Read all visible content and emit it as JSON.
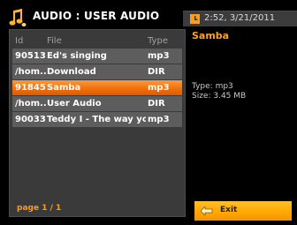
{
  "header": {
    "title": "AUDIO : USER AUDIO",
    "datetime": "2:52, 3/21/2011",
    "logo_icon": "music-notes-icon",
    "clock_icon": "clock-icon"
  },
  "list": {
    "columns": {
      "id": "Id",
      "file": "File",
      "type": "Type"
    },
    "rows": [
      {
        "id": "90513",
        "file": "Ed's singing",
        "type": "mp3",
        "selected": false
      },
      {
        "id": "/hom...",
        "file": "Download",
        "type": "DIR",
        "selected": false
      },
      {
        "id": "91845",
        "file": "Samba",
        "type": "mp3",
        "selected": true
      },
      {
        "id": "/hom...",
        "file": "User Audio",
        "type": "DIR",
        "selected": false
      },
      {
        "id": "90033",
        "file": "Teddy I - The way you",
        "type": "mp3",
        "selected": false
      }
    ],
    "page_label": "page 1 / 1"
  },
  "details": {
    "title": "Samba",
    "type_line": "Type: mp3",
    "size_line": "Size: 3.45 MB"
  },
  "footer": {
    "exit_label": "Exit",
    "exit_icon": "back-arrow-icon"
  },
  "colors": {
    "accent": "#ffa21a",
    "selected_row": "#f0700d",
    "row_bg": "#5d5d5d",
    "panel_bg": "#3a3a3a",
    "exit_button": "#ffa600"
  }
}
